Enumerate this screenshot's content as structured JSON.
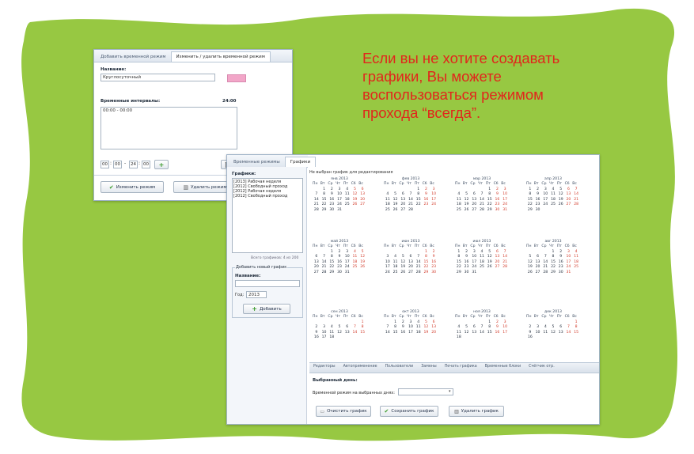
{
  "callout": {
    "lines": [
      "Если вы не хотите создавать",
      "графики, Вы можете",
      "воспользоваться режимом",
      "прохода “всегда”."
    ]
  },
  "colors": {
    "background_blob": "#97c842",
    "callout_text": "#e1261c",
    "weekend": "#d23a2a",
    "swatch": "#f2a6c8",
    "accent_green": "#3a9a2a"
  },
  "win1": {
    "tabs": [
      "Добавить временной режим",
      "Изменить / удалить временной режим"
    ],
    "name_label": "Название:",
    "name_value": "Круглосуточный",
    "intervals_label": "Временные интервалы:",
    "total": "24:00",
    "interval_item": "00:00 - 00:00",
    "time": {
      "h1": "00",
      "m1": "00",
      "dash": "-",
      "h2": "24",
      "m2": "00",
      "sep": ":"
    },
    "add_icon": "plus-icon",
    "delete_icon": "trash-icon",
    "btn_change": "Изменить режим",
    "btn_delete": "Удалить режим"
  },
  "win2": {
    "tabs": [
      "Временные режимы",
      "Графики"
    ],
    "schedules_label": "Графики:",
    "schedules": [
      "[2013] Рабочая неделя",
      "[2012] Свободный проход",
      "[2012] Рабочая неделя",
      "[2012] Свободный проход"
    ],
    "count_text": "Всего графиков: 4 из 200",
    "new_group_title": "Добавить новый график",
    "new_name_label": "Название:",
    "year_label": "Год:",
    "year_value": "2013",
    "add_button": "Добавить",
    "status_text": "Не выбран график для редактирования",
    "months": [
      {
        "title": "янв 2013",
        "start": 1,
        "days": 31
      },
      {
        "title": "фев 2013",
        "start": 4,
        "days": 28
      },
      {
        "title": "мар 2013",
        "start": 4,
        "days": 31
      },
      {
        "title": "апр 2013",
        "start": 0,
        "days": 30
      },
      {
        "title": "май 2013",
        "start": 2,
        "days": 31
      },
      {
        "title": "июн 2013",
        "start": 5,
        "days": 30
      },
      {
        "title": "июл 2013",
        "start": 0,
        "days": 31
      },
      {
        "title": "авг 2013",
        "start": 3,
        "days": 31
      },
      {
        "title": "сен 2013",
        "start": 6,
        "days": 18
      },
      {
        "title": "окт 2013",
        "start": 1,
        "days": 20
      },
      {
        "title": "ноя 2013",
        "start": 4,
        "days": 18
      },
      {
        "title": "дек 2013",
        "start": 6,
        "days": 16
      }
    ],
    "weekdays": [
      "Пн",
      "Вт",
      "Ср",
      "Чт",
      "Пт",
      "Сб",
      "Вс"
    ],
    "bottom_tabs": [
      "Редакторы",
      "Автоприменение",
      "Пользователи",
      "Замены",
      "Печать графика",
      "Временные блоки",
      "Счётчик отр."
    ],
    "selected_days_label": "Выбранный день:",
    "mode_label": "Временной режим на выбранных днях:",
    "btn_clear": "Очистить график",
    "btn_save": "Сохранить график",
    "btn_delete": "Удалить график"
  }
}
